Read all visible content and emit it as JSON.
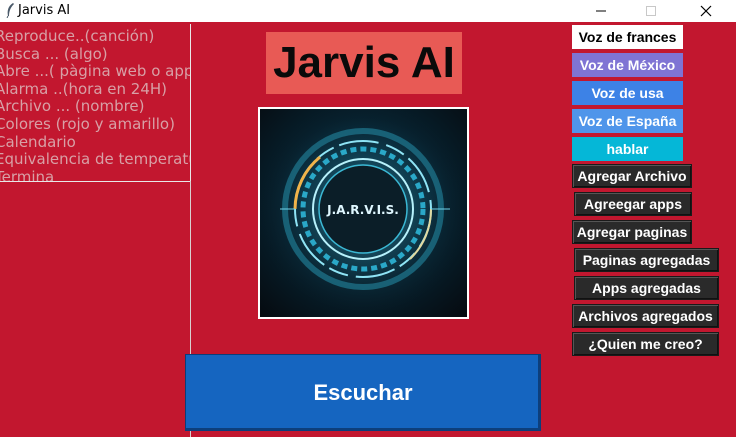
{
  "window": {
    "title": "Jarvis AI",
    "minimize_glyph": "—",
    "maximize_glyph": "☐",
    "close_glyph": "✕",
    "app_icon": "feather-icon"
  },
  "commands": [
    "Reproduce..(canción)",
    "Busca ... (algo)",
    "Abre ...( pàgina web o app)",
    "Alarma ..(hora en 24H)",
    "Archivo ... (nombre)",
    "Colores (rojo y amarillo)",
    "Calendario",
    "Equivalencia de temperaturas",
    "Termina"
  ],
  "header": {
    "title": "Jarvis AI"
  },
  "logo": {
    "text": "J.A.R.V.I.S."
  },
  "listen": {
    "label": "Escuchar"
  },
  "voices": [
    {
      "label": "Voz de frances",
      "bg": "#ffffff",
      "fg": "#000000"
    },
    {
      "label": "Voz de México",
      "bg": "#7f74d4",
      "fg": "#ffffff"
    },
    {
      "label": "Voz de usa",
      "bg": "#3d82e6",
      "fg": "#ffffff"
    },
    {
      "label": "Voz de España",
      "bg": "#4f95ea",
      "fg": "#ffffff"
    },
    {
      "label": "hablar",
      "bg": "#05b7d7",
      "fg": "#ffffff"
    }
  ],
  "actions": [
    "Agregar Archivo",
    "Agreegar apps",
    "Agregar paginas",
    "Paginas agregadas",
    "Apps agregadas",
    "Archivos agregados",
    "¿Quien me creo?"
  ],
  "colors": {
    "background": "#c2172f",
    "title_bg": "#e85a55",
    "listen_bg": "#1565c0",
    "dark_button": "#2a2a2a"
  }
}
